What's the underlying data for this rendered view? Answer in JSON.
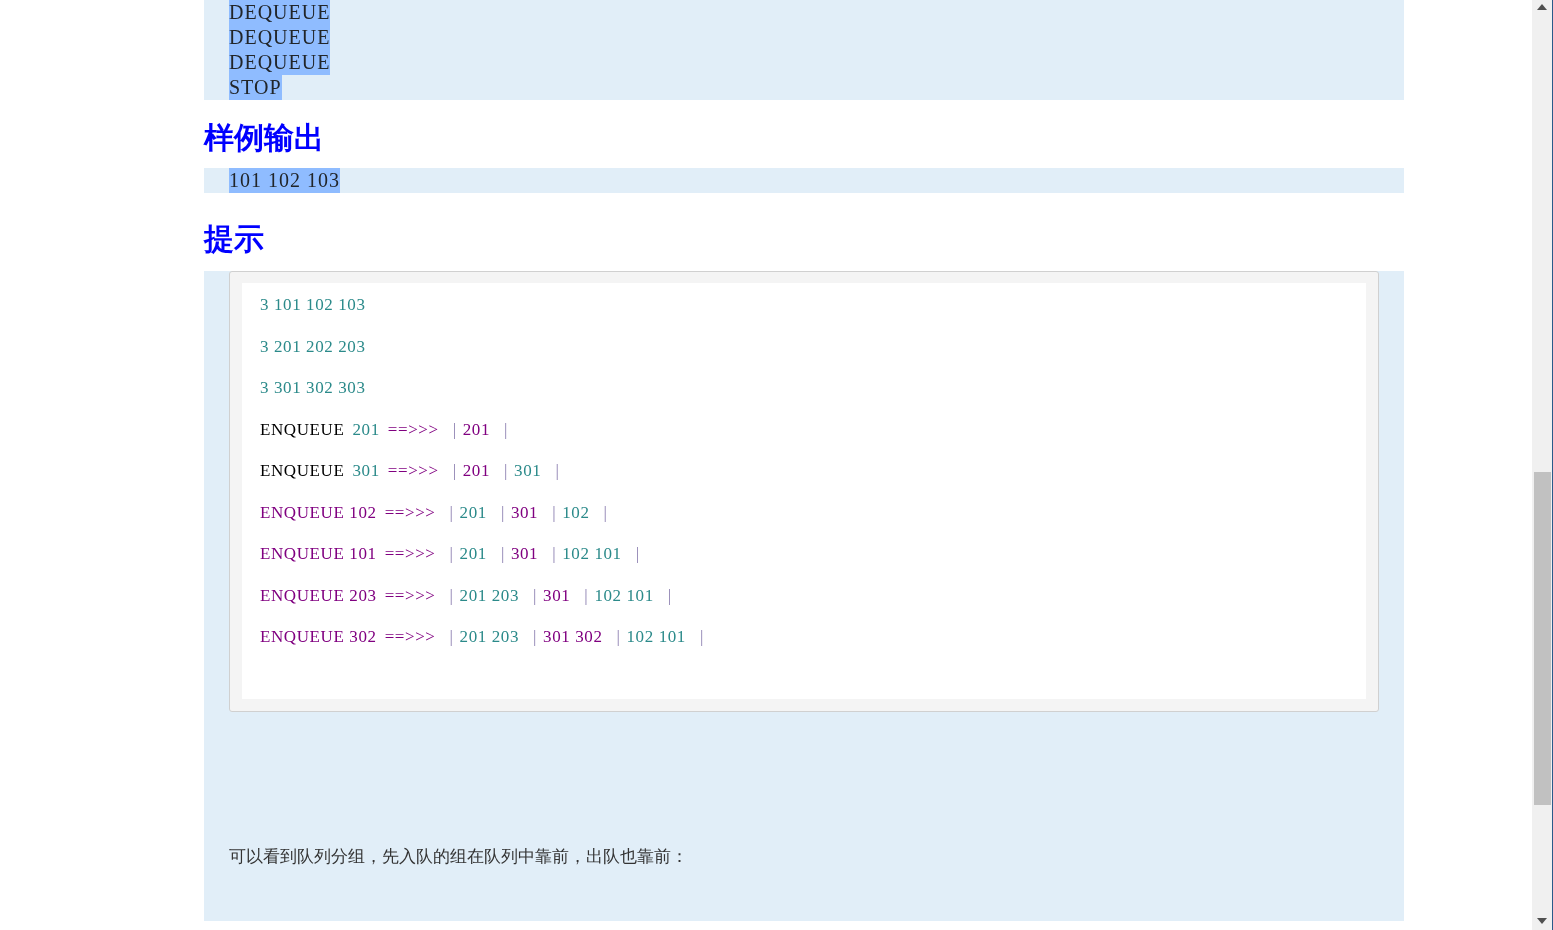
{
  "sample_input": {
    "lines": [
      {
        "text": "DEQUEUE",
        "highlighted": true
      },
      {
        "text": "DEQUEUE",
        "highlighted": true
      },
      {
        "text": "DEQUEUE",
        "highlighted": true
      },
      {
        "text": "STOP",
        "highlighted": true
      }
    ]
  },
  "sample_output": {
    "heading": "样例输出",
    "lines": [
      {
        "text": "101 102 103",
        "highlighted": true
      }
    ]
  },
  "hint": {
    "heading": "提示",
    "code_lines": [
      [
        {
          "kind": "text",
          "text": "3 101 102 103",
          "color": "#2b8a8a"
        }
      ],
      [
        {
          "kind": "text",
          "text": "3 201 202 203",
          "color": "#2b8a8a"
        }
      ],
      [
        {
          "kind": "text",
          "text": "3 301 302 303",
          "color": "#2b8a8a"
        }
      ],
      [
        {
          "kind": "text",
          "text": "ENQUEUE",
          "color": "#000000"
        },
        {
          "kind": "text",
          "text": "201",
          "color": "#2b8a8a"
        },
        {
          "kind": "text",
          "text": "==>>>",
          "color": "#800080"
        },
        {
          "kind": "separator",
          "text": "|"
        },
        {
          "kind": "text",
          "text": "201",
          "color": "#800080"
        },
        {
          "kind": "separator",
          "text": "|"
        }
      ],
      [
        {
          "kind": "text",
          "text": "ENQUEUE",
          "color": "#000000"
        },
        {
          "kind": "text",
          "text": "301",
          "color": "#2b8a8a"
        },
        {
          "kind": "text",
          "text": "==>>>",
          "color": "#800080"
        },
        {
          "kind": "separator",
          "text": "|"
        },
        {
          "kind": "text",
          "text": "201",
          "color": "#800080"
        },
        {
          "kind": "separator",
          "text": "|"
        },
        {
          "kind": "text",
          "text": "301",
          "color": "#2b8a8a"
        },
        {
          "kind": "separator",
          "text": "|"
        }
      ],
      [
        {
          "kind": "text",
          "text": "ENQUEUE 102",
          "color": "#800080"
        },
        {
          "kind": "text",
          "text": "==>>>",
          "color": "#800080"
        },
        {
          "kind": "separator",
          "text": "|"
        },
        {
          "kind": "text",
          "text": "201",
          "color": "#2b8a8a"
        },
        {
          "kind": "separator",
          "text": "|"
        },
        {
          "kind": "text",
          "text": "301",
          "color": "#800080"
        },
        {
          "kind": "separator",
          "text": "|"
        },
        {
          "kind": "text",
          "text": "102",
          "color": "#2b8a8a"
        },
        {
          "kind": "separator",
          "text": "|"
        }
      ],
      [
        {
          "kind": "text",
          "text": "ENQUEUE 101",
          "color": "#800080"
        },
        {
          "kind": "text",
          "text": "==>>>",
          "color": "#800080"
        },
        {
          "kind": "separator",
          "text": "|"
        },
        {
          "kind": "text",
          "text": "201",
          "color": "#2b8a8a"
        },
        {
          "kind": "separator",
          "text": "|"
        },
        {
          "kind": "text",
          "text": "301",
          "color": "#800080"
        },
        {
          "kind": "separator",
          "text": "|"
        },
        {
          "kind": "text",
          "text": "102 101",
          "color": "#2b8a8a"
        },
        {
          "kind": "separator",
          "text": "|"
        }
      ],
      [
        {
          "kind": "text",
          "text": "ENQUEUE 203",
          "color": "#800080"
        },
        {
          "kind": "text",
          "text": "==>>>",
          "color": "#800080"
        },
        {
          "kind": "separator",
          "text": "|"
        },
        {
          "kind": "text",
          "text": "201 203",
          "color": "#2b8a8a"
        },
        {
          "kind": "separator",
          "text": "|"
        },
        {
          "kind": "text",
          "text": "301",
          "color": "#800080"
        },
        {
          "kind": "separator",
          "text": "|"
        },
        {
          "kind": "text",
          "text": "102 101",
          "color": "#2b8a8a"
        },
        {
          "kind": "separator",
          "text": "|"
        }
      ],
      [
        {
          "kind": "text",
          "text": "ENQUEUE 302",
          "color": "#800080"
        },
        {
          "kind": "text",
          "text": "==>>>",
          "color": "#800080"
        },
        {
          "kind": "separator",
          "text": "|"
        },
        {
          "kind": "text",
          "text": "201 203",
          "color": "#2b8a8a"
        },
        {
          "kind": "separator",
          "text": "|"
        },
        {
          "kind": "text",
          "text": "301 302",
          "color": "#800080"
        },
        {
          "kind": "separator",
          "text": "|"
        },
        {
          "kind": "text",
          "text": "102 101",
          "color": "#2b8a8a"
        },
        {
          "kind": "separator",
          "text": "|"
        }
      ]
    ],
    "paragraph": "可以看到队列分组，先入队的组在队列中靠前，出队也靠前："
  }
}
